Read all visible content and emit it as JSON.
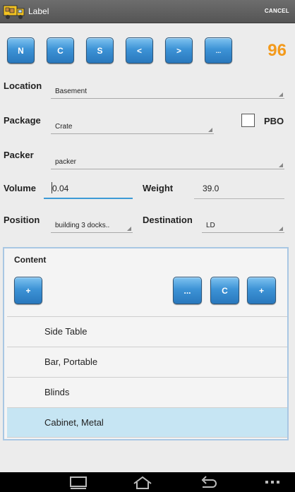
{
  "header": {
    "title": "Label",
    "cancel_label": "CANCEL"
  },
  "toolbar": {
    "buttons": [
      "N",
      "C",
      "S",
      "<",
      ">",
      "..."
    ],
    "count": "96"
  },
  "form": {
    "location_label": "Location",
    "location_value": "Basement",
    "package_label": "Package",
    "package_value": "Crate",
    "pbo_label": "PBO",
    "packer_label": "Packer",
    "packer_value": "packer",
    "volume_label": "Volume",
    "volume_value": "0.04",
    "weight_label": "Weight",
    "weight_value": "39.0",
    "position_label": "Position",
    "position_value": "building 3 docks..",
    "destination_label": "Destination",
    "destination_value": "LD"
  },
  "content": {
    "title": "Content",
    "add_left_label": "+",
    "more_label": "...",
    "c_label": "C",
    "add_right_label": "+",
    "items": [
      "Side Table",
      "Bar, Portable",
      "Blinds",
      "Cabinet, Metal"
    ]
  },
  "colors": {
    "accent": "#3d9ad6",
    "count": "#f39a1c",
    "selected_row": "#c6e5f3"
  }
}
